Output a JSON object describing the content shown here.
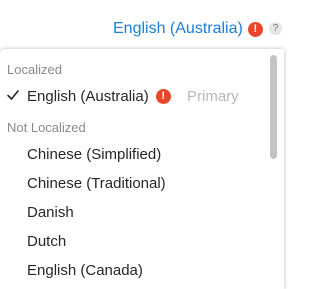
{
  "language_selector": {
    "current": "English (Australia)",
    "warning_glyph": "!",
    "help_glyph": "?"
  },
  "dropdown": {
    "localized_header": "Localized",
    "localized_items": [
      {
        "label": "English (Australia)",
        "tag": "Primary",
        "checked": true,
        "warning": true
      }
    ],
    "not_localized_header": "Not Localized",
    "not_localized_items": [
      {
        "label": "Chinese (Simplified)"
      },
      {
        "label": "Chinese (Traditional)"
      },
      {
        "label": "Danish"
      },
      {
        "label": "Dutch"
      },
      {
        "label": "English (Canada)"
      }
    ]
  },
  "colors": {
    "accent": "#1a7fdc",
    "warning": "#e8472a"
  },
  "icons": [
    "warning-icon",
    "chevron-down-icon",
    "help-icon",
    "checkmark-icon"
  ]
}
